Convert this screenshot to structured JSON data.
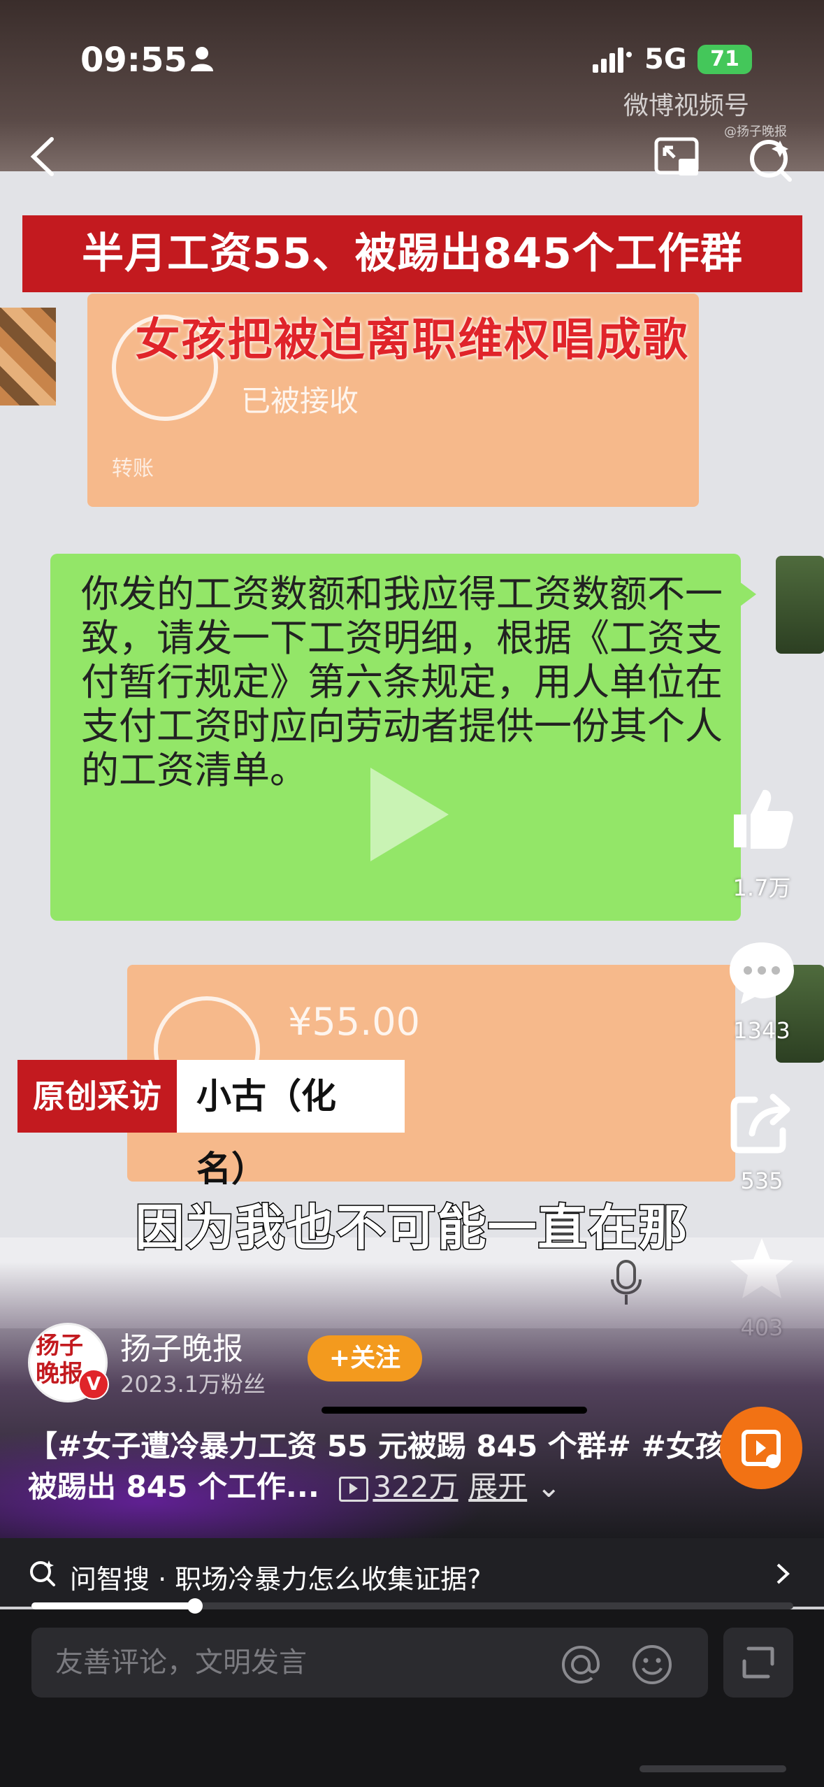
{
  "status": {
    "time": "09:55",
    "network": "5G",
    "battery": "71"
  },
  "header": {
    "watermark": "微博视频号",
    "watermark_sub": "@扬子晚报"
  },
  "video": {
    "headline1": "半月工资55、被踢出845个工作群",
    "headline2": "女孩把被迫离职维权唱成歌",
    "card1_text": "已被接收",
    "card1_small": "转账",
    "bubble_text": "你发的工资数额和我应得工资数额不一致，请发一下工资明细，根据《工资支付暂行规定》第六条规定，用人单位在支付工资时应向劳动者提供一份其个人的工资清单。",
    "card2_amount": "¥55.00",
    "tag_label": "原创采访",
    "tag_name": "小古（化名）",
    "subtitle": "因为我也不可能一直在那"
  },
  "rail": {
    "likes": "1.7万",
    "comments": "1343",
    "shares": "535",
    "favorites": "403"
  },
  "author": {
    "name": "扬子晚报",
    "fans": "2023.1万粉丝",
    "follow_label": "+关注",
    "verified": "V"
  },
  "description": {
    "text": "【#女子遭冷暴力工资 55 元被踢 845 个群# #女孩被踢出 845 个工作...",
    "views": "322万",
    "expand": "展开"
  },
  "smart_search": {
    "text": "问智搜 · 职场冷暴力怎么收集证据?"
  },
  "playback": {
    "progress": 0.215
  },
  "comment": {
    "placeholder": "友善评论，文明发言"
  }
}
